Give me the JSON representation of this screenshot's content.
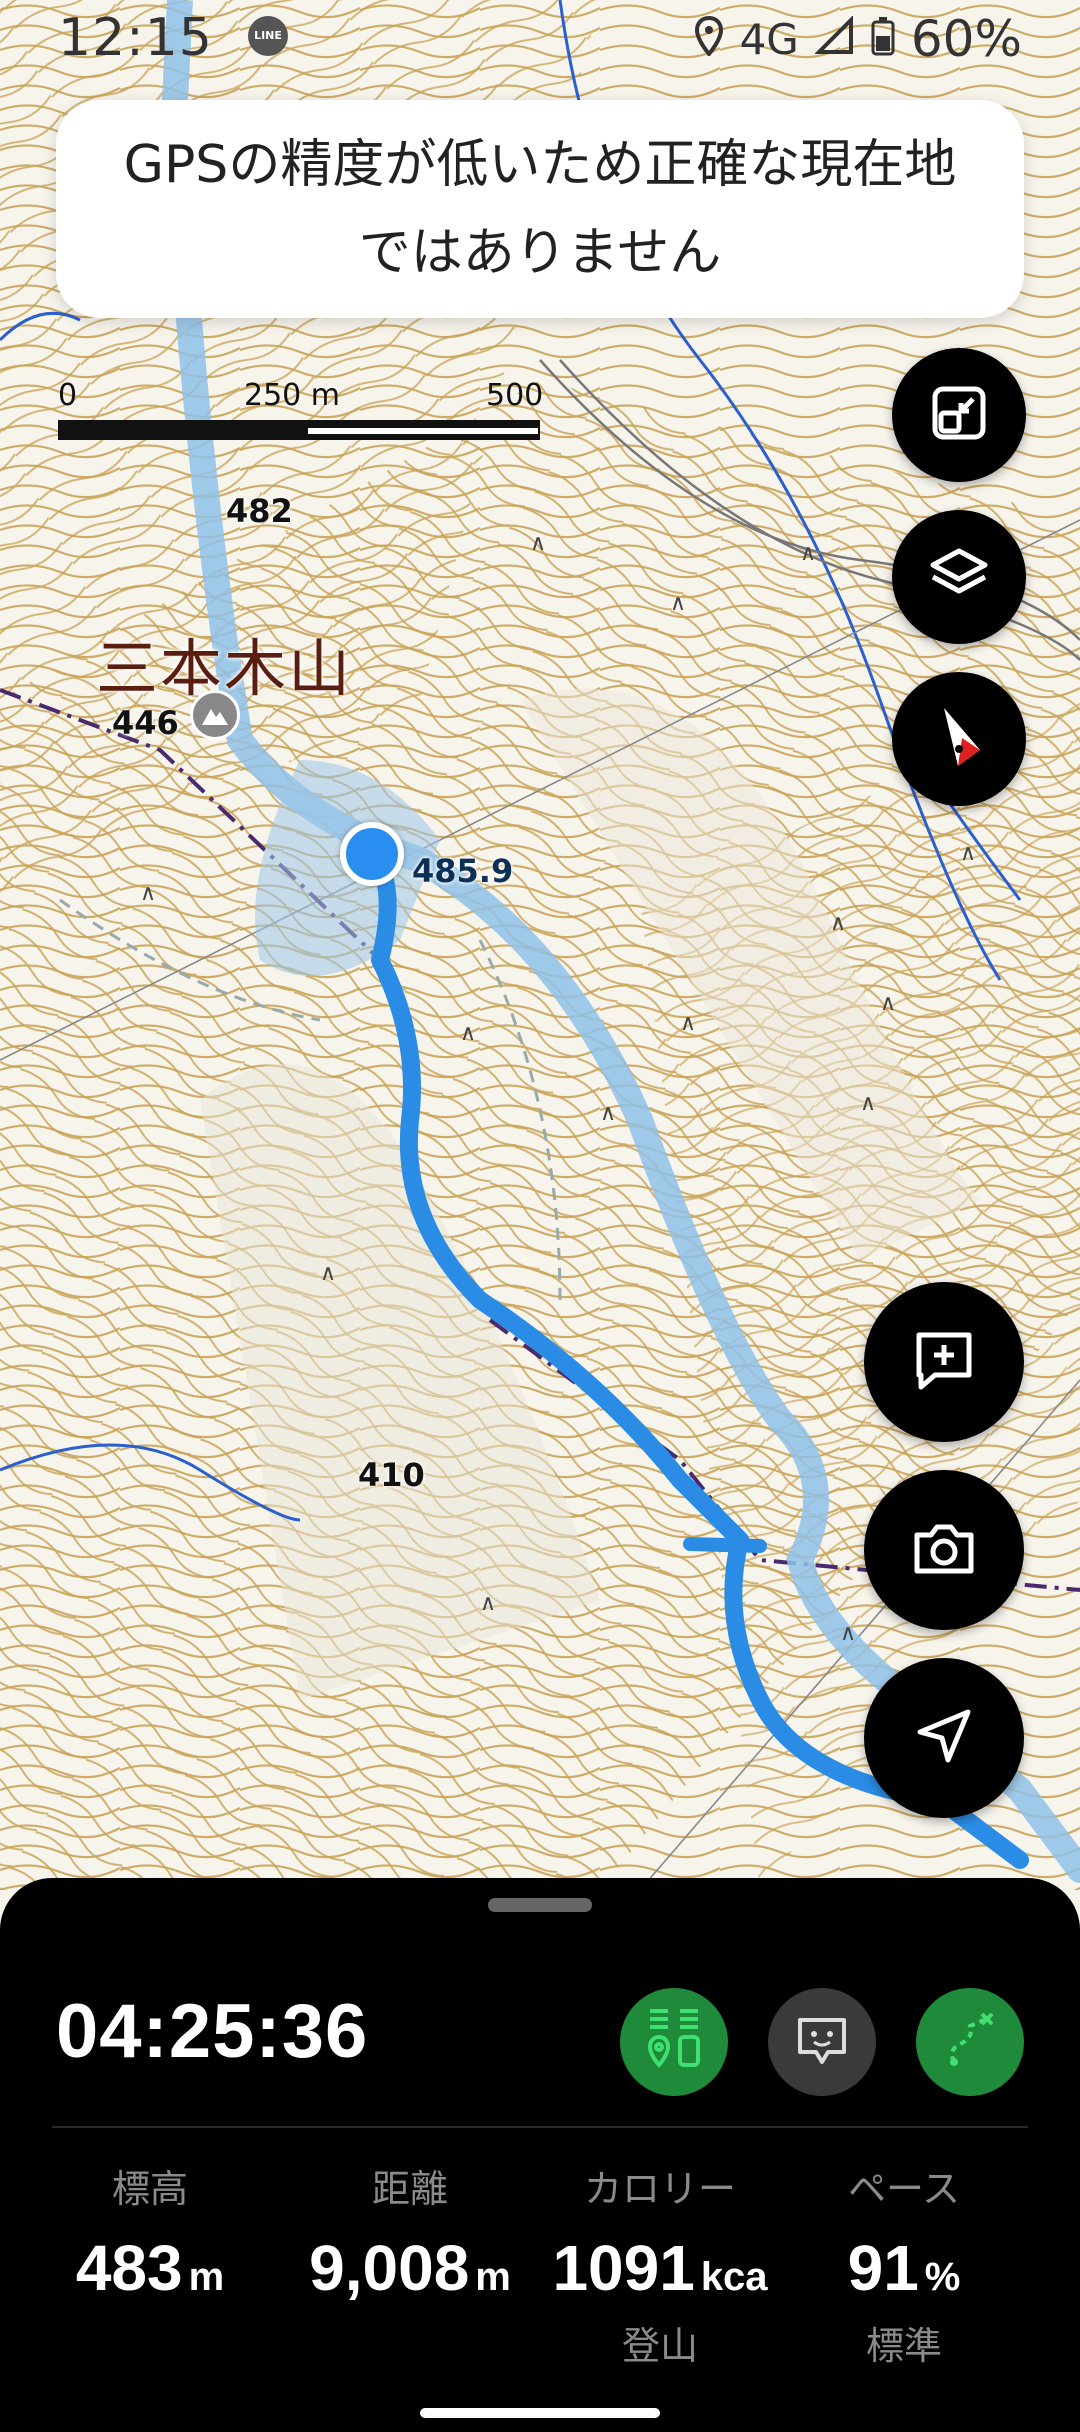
{
  "status_bar": {
    "time": "12:15",
    "app_badge": "LINE",
    "network": "4G",
    "battery": "60%"
  },
  "banner": {
    "text": "GPSの精度が低いため正確な現在地ではありません"
  },
  "scale_bar": {
    "zero": "0",
    "mid": "250 m",
    "max": "500 m"
  },
  "map": {
    "peak_name": "三本木山",
    "peak_elevation": "446",
    "spot_heights": [
      "482",
      "410"
    ],
    "current_elevation": "485.9",
    "colors": {
      "contour": "#c9a458",
      "track": "#2b8ce6",
      "planned_route": "#9ccbec",
      "boundary": "#4a2a6e",
      "water": "#2a5fd0",
      "location_dot": "#2a8ef0"
    }
  },
  "map_controls": {
    "fit": "fit-screen-icon",
    "layers": "layers-icon",
    "compass": "compass-icon",
    "add_memo": "add-memo-icon",
    "camera": "camera-icon",
    "navigate": "navigation-arrow-icon"
  },
  "panel": {
    "elapsed_time": "04:25:36",
    "stats": [
      {
        "title": "標高",
        "value": "483",
        "unit": "m",
        "sub": ""
      },
      {
        "title": "距離",
        "value": "9,008",
        "unit": "m",
        "sub": ""
      },
      {
        "title": "カロリー",
        "value": "1091",
        "unit": "kca",
        "sub": "登山"
      },
      {
        "title": "ペース",
        "value": "91",
        "unit": "%",
        "sub": "標準"
      }
    ],
    "buttons": {
      "checkpoint": "checkpoint-icon",
      "voice_guide": "speech-bubble-face-icon",
      "route": "route-icon"
    },
    "button_color": "#1f8a3a",
    "icon_accent": "#40e070"
  }
}
